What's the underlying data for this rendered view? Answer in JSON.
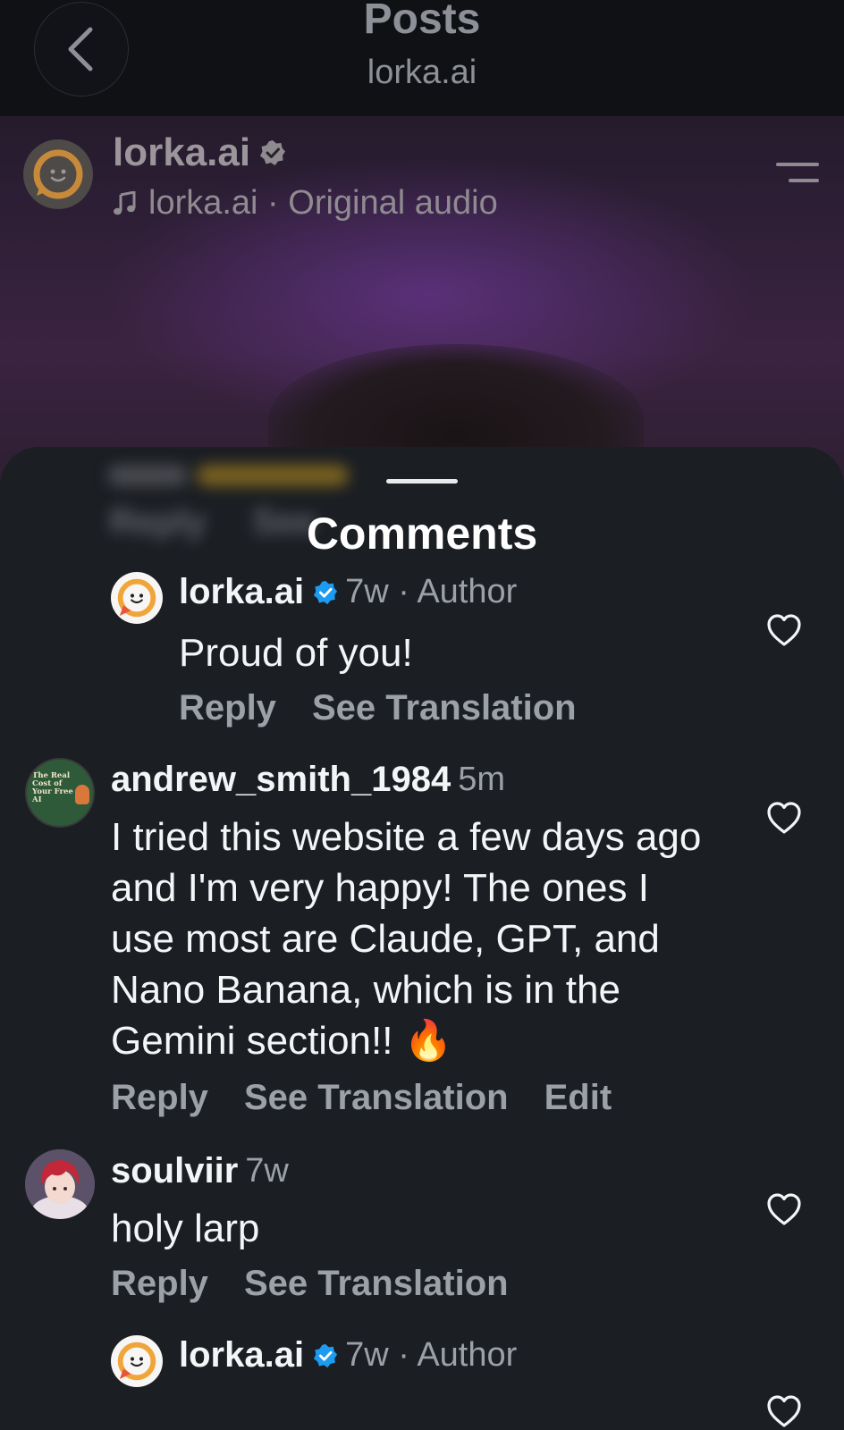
{
  "header": {
    "title": "Posts",
    "subtitle": "lorka.ai"
  },
  "post": {
    "author": "lorka.ai",
    "audio_label": "lorka.ai · Original audio"
  },
  "sheet": {
    "title": "Comments",
    "ghost_reply": "Reply",
    "ghost_see": "See"
  },
  "comments": [
    {
      "user": "lorka.ai",
      "verified": true,
      "meta": "7w · Author",
      "text": "Proud of you!",
      "actions": [
        "Reply",
        "See Translation"
      ]
    },
    {
      "user": "andrew_smith_1984",
      "verified": false,
      "meta": "5m",
      "avatar_text": "The Real Cost of Your Free AI",
      "text": "I tried this website a few days ago and I'm very happy! The ones I use most are Claude, GPT, and Nano Banana, which is in the Gemini section!! 🔥",
      "actions": [
        "Reply",
        "See Translation",
        "Edit"
      ]
    },
    {
      "user": "soulviir",
      "verified": false,
      "meta": "7w",
      "text": "holy larp",
      "actions": [
        "Reply",
        "See Translation"
      ]
    },
    {
      "user": "lorka.ai",
      "verified": true,
      "meta": "7w · Author",
      "text": "",
      "actions": []
    }
  ],
  "colors": {
    "sheet_bg": "#1b1e23",
    "verified_blue": "#1d9bf0",
    "muted_text": "#9ca0a7",
    "lorka_brand": "#f0a53a"
  },
  "icons": [
    "back-chevron-icon",
    "verified-icon",
    "music-note-icon",
    "menu-icon",
    "heart-icon"
  ]
}
